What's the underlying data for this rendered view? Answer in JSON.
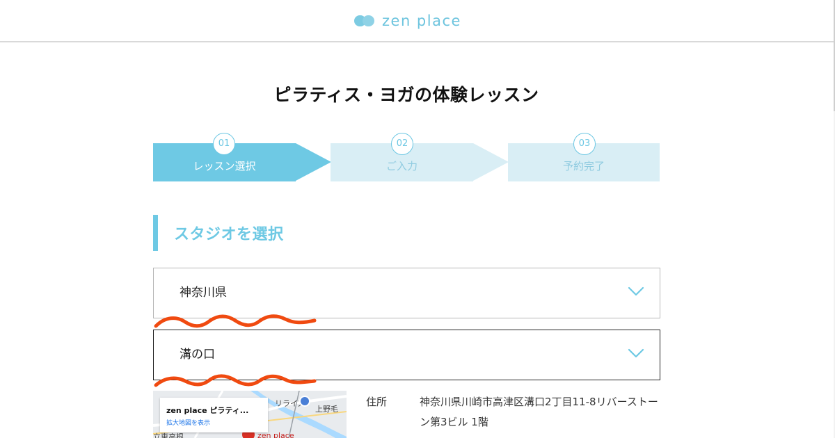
{
  "header": {
    "logo_text": "zen place",
    "logo_icon": "twin-circle-logo-mark",
    "brand_color": "#6ec9e4"
  },
  "page": {
    "title": "ピラティス・ヨガの体験レッスン"
  },
  "steps": [
    {
      "number": "01",
      "label": "レッスン選択",
      "active": true
    },
    {
      "number": "02",
      "label": "ご入力",
      "active": false
    },
    {
      "number": "03",
      "label": "予約完了",
      "active": false
    }
  ],
  "section": {
    "title": "スタジオを選択"
  },
  "prefecture_select": {
    "value": "神奈川県",
    "icon": "chevron-down-icon"
  },
  "studio_select": {
    "value": "溝の口",
    "icon": "chevron-down-icon"
  },
  "map": {
    "card_title": "zen place ピラティ...",
    "card_link": "拡大地図を表示",
    "label_station": "上野毛",
    "label_rise": "リライズ",
    "label_pin": "zen place",
    "label_left": "立東高根"
  },
  "address": {
    "label": "住所",
    "line1": "神奈川県川崎市高津区溝口2丁目11-8リバーストー",
    "line2": "ン第3ビル 1階"
  },
  "colors": {
    "accent": "#6ec9e4",
    "inactive_step": "#d9eef5",
    "annotation": "#f04a10"
  }
}
